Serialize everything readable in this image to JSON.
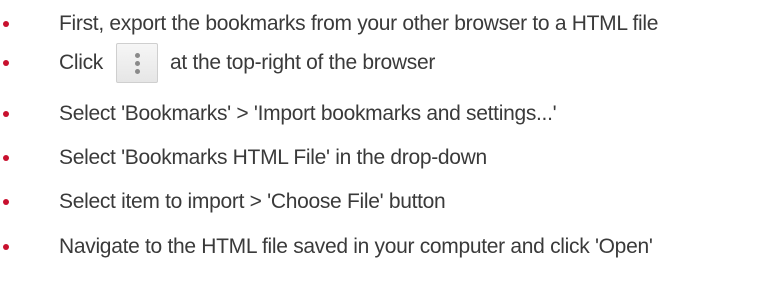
{
  "colors": {
    "bullet": "#c8102e",
    "text": "#3a3a3a",
    "button_border": "#cfcfcf",
    "button_dots": "#8a8a8a"
  },
  "steps": [
    {
      "text": "First, export the bookmarks from your other browser to a HTML file"
    },
    {
      "text_before": "Click",
      "icon": "more-vertical-icon",
      "text_after": "at the top-right of the browser"
    },
    {
      "text": "Select 'Bookmarks' > 'Import bookmarks and settings...'"
    },
    {
      "text": "Select 'Bookmarks HTML File' in the drop-down"
    },
    {
      "text": "Select item to import > 'Choose File' button"
    },
    {
      "text": "Navigate to the HTML file saved in your computer and click 'Open'"
    }
  ]
}
